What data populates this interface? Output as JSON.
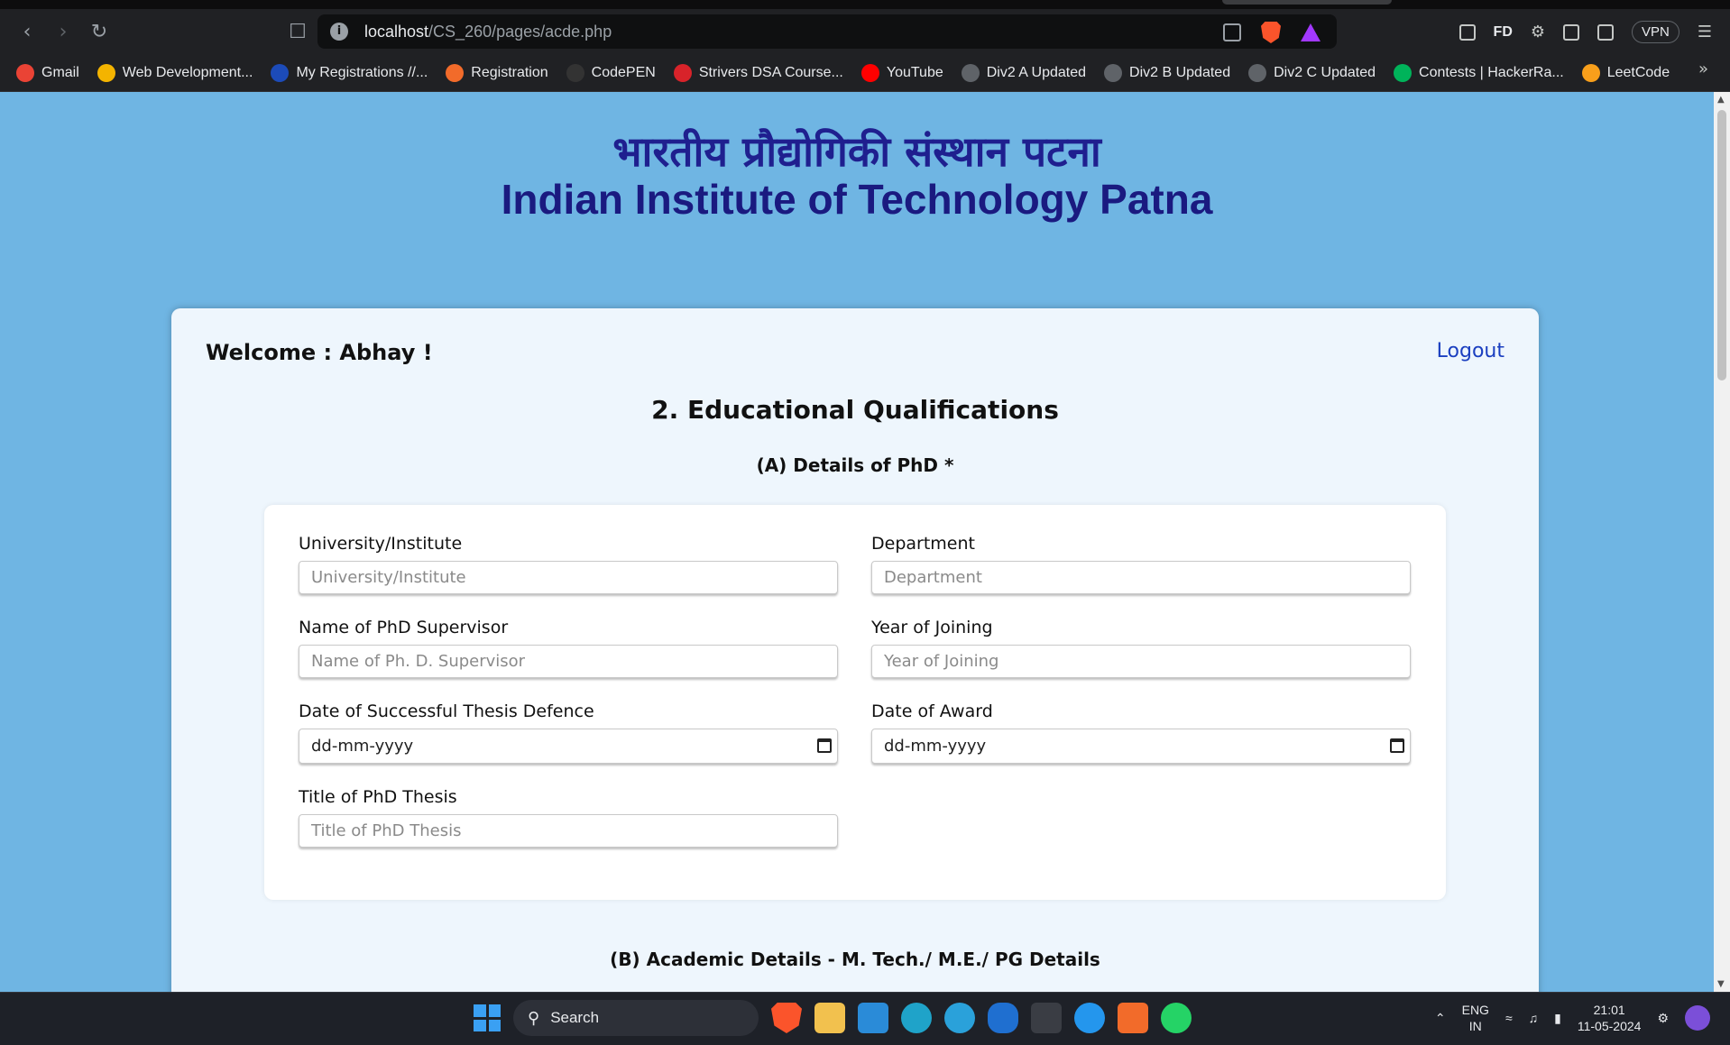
{
  "browser": {
    "url_host": "localhost",
    "url_path": "/CS_260/pages/acde.php",
    "vpn_label": "VPN",
    "fd_label": "FD",
    "bookmarks": [
      {
        "label": "Gmail",
        "icon": "gmail-icon",
        "color": "#ea4335"
      },
      {
        "label": "Web Development...",
        "icon": "web-dev-icon",
        "color": "#f4b400"
      },
      {
        "label": "My Registrations //...",
        "icon": "unstop-icon",
        "color": "#1c4bb8"
      },
      {
        "label": "Registration",
        "icon": "codechef-icon",
        "color": "#f26b2a"
      },
      {
        "label": "CodePEN",
        "icon": "codepen-icon",
        "color": "#333333"
      },
      {
        "label": "Strivers DSA Course...",
        "icon": "tuf-icon",
        "color": "#d8232a"
      },
      {
        "label": "YouTube",
        "icon": "youtube-icon",
        "color": "#ff0000"
      },
      {
        "label": "Div2 A Updated",
        "icon": "globe-icon",
        "color": "#5f6368"
      },
      {
        "label": "Div2 B Updated",
        "icon": "globe-icon",
        "color": "#5f6368"
      },
      {
        "label": "Div2 C Updated",
        "icon": "globe-icon",
        "color": "#5f6368"
      },
      {
        "label": "Contests | HackerRa...",
        "icon": "hackerrank-icon",
        "color": "#00b35a"
      },
      {
        "label": "LeetCode",
        "icon": "leetcode-icon",
        "color": "#f89f1b"
      }
    ]
  },
  "page": {
    "title_hindi": "भारतीय प्रौद्योगिकी संस्थान पटना",
    "title_english": "Indian Institute of Technology Patna",
    "welcome": "Welcome : Abhay !",
    "logout": "Logout",
    "section_title": "2. Educational Qualifications",
    "sub_a": "(A) Details of PhD *",
    "sub_b": "(B) Academic Details - M. Tech./ M.E./ PG Details",
    "fields": {
      "university": {
        "label": "University/Institute",
        "placeholder": "University/Institute"
      },
      "department": {
        "label": "Department",
        "placeholder": "Department"
      },
      "supervisor": {
        "label": "Name of PhD Supervisor",
        "placeholder": "Name of Ph. D. Supervisor"
      },
      "year_joining": {
        "label": "Year of Joining",
        "placeholder": "Year of Joining"
      },
      "defence_date": {
        "label": "Date of Successful Thesis Defence",
        "value": "dd-mm-yyyy"
      },
      "award_date": {
        "label": "Date of Award",
        "value": "dd-mm-yyyy"
      },
      "thesis_title": {
        "label": "Title of PhD Thesis",
        "placeholder": "Title of PhD Thesis"
      }
    }
  },
  "taskbar": {
    "search_label": "Search",
    "lang_line1": "ENG",
    "lang_line2": "IN",
    "time": "21:01",
    "date": "11-05-2024"
  },
  "colors": {
    "page_bg": "#6fb5e3",
    "title_color": "#1a1a80",
    "logout_color": "#1b3fc0"
  }
}
